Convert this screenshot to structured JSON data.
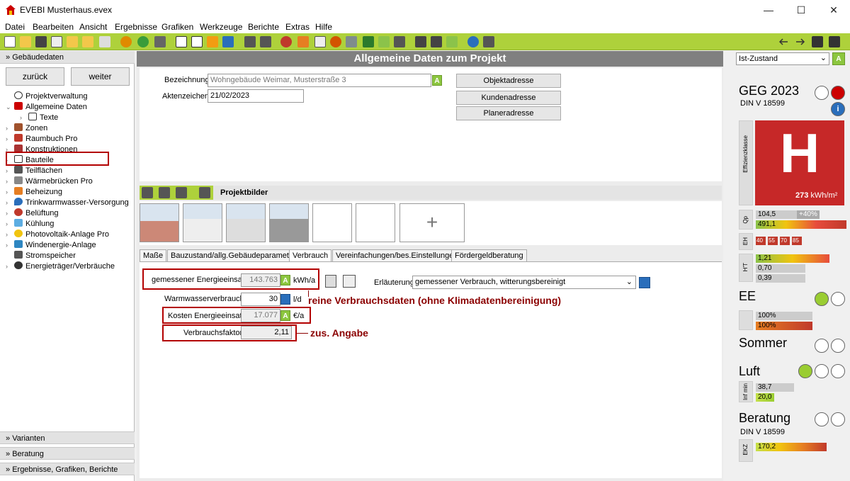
{
  "window": {
    "title": "EVEBI Musterhaus.evex",
    "min": "—",
    "max": "☐",
    "close": "✕"
  },
  "menu": [
    "Datei",
    "Bearbeiten",
    "Ansicht",
    "Ergebnisse",
    "Grafiken",
    "Werkzeuge",
    "Berichte",
    "Extras",
    "Hilfe"
  ],
  "left": {
    "header": "Gebäudedaten",
    "back": "zurück",
    "next": "weiter",
    "tree": [
      "Projektverwaltung",
      "Allgemeine Daten",
      "Texte",
      "Zonen",
      "Raumbuch Pro",
      "Konstruktionen",
      "Bauteile",
      "Teilflächen",
      "Wärmebrücken Pro",
      "Beheizung",
      "Trinkwarmwasser-Versorgung",
      "Belüftung",
      "Kühlung",
      "Photovoltaik-Anlage Pro",
      "Windenergie-Anlage",
      "Stromspeicher",
      "Energieträger/Verbräuche"
    ],
    "sections": [
      "Varianten",
      "Beratung",
      "Ergebnisse, Grafiken, Berichte"
    ]
  },
  "center": {
    "heading": "Allgemeine Daten zum Projekt",
    "bez_label": "Bezeichnung",
    "bez_value": "Wohngebäude Weimar, Musterstraße 3",
    "akt_label": "Aktenzeichen",
    "akt_value": "21/02/2023",
    "btn_obj": "Objektadresse",
    "btn_kunde": "Kundenadresse",
    "btn_plan": "Planeradresse",
    "bilder_title": "Projektbilder",
    "plus": "+",
    "tabs": [
      "Maße",
      "Bauzustand/allg.Gebäudeparameter",
      "Verbrauch",
      "Vereinfachungen/bes.Einstellungen",
      "Fördergeldberatung"
    ],
    "verbrauch": {
      "e_label": "gemessener Energieeinsatz",
      "e_value": "143.763",
      "e_unit": "kWh/a",
      "ww_label": "Warmwasserverbrauch",
      "ww_value": "30",
      "ww_unit": "l/d",
      "k_label": "Kosten Energieeinsatz",
      "k_value": "17.077",
      "k_unit": "€/a",
      "vf_label": "Verbrauchsfaktor",
      "vf_value": "2,11",
      "erl_label": "Erläuterung",
      "erl_value": "gemessener Verbrauch, witterungsbereinigt",
      "note1": "reine Verbrauchsdaten (ohne Klimadatenbereinigung)",
      "note2": "zus. Angabe",
      "a": "A"
    }
  },
  "right": {
    "state": "Ist-Zustand",
    "geg": "GEG 2023",
    "din": "DIN V 18599",
    "eff_label": "Effizienzklasse",
    "klasse": "H",
    "kwh": "273",
    "kwh_unit": "kWh/m²",
    "qp_label": "Qp",
    "qp1": "104,5",
    "qp1b": "+40%",
    "qp2": "491,1",
    "eh_label": "EH",
    "eh": [
      "40",
      "55",
      "70",
      "85"
    ],
    "ht_label": "H'T",
    "ht": [
      "1,21",
      "0,70",
      "0,39"
    ],
    "ee": "EE",
    "ee1": "100%",
    "ee2": "100%",
    "sommer": "Sommer",
    "luft": "Luft",
    "inf_label": "Inf min",
    "luft1": "38,7",
    "luft2": "20,0",
    "beratung": "Beratung",
    "din2": "DIN V 18599",
    "ekz_label": "EKZ",
    "ekz": "170,2",
    "info": "i"
  }
}
